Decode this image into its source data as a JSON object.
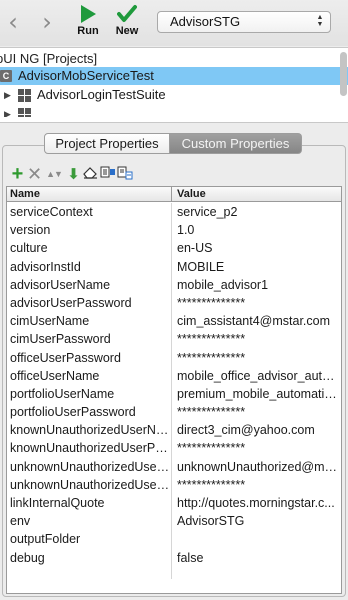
{
  "toolbar": {
    "run_label": "Run",
    "new_label": "New",
    "environment": "AdvisorSTG",
    "back_icon": "chevron-left-icon",
    "forward_icon": "chevron-right-icon",
    "run_icon": "play-icon",
    "new_icon": "checkmark-icon",
    "run_color": "#1f9a3c",
    "new_color": "#1f9a3c"
  },
  "tree": {
    "root_label": "pUI NG [Projects]",
    "suite_badge": "C",
    "suite_label": "AdvisorMobServiceTest",
    "login_suite_label": "AdvisorLoginTestSuite",
    "selection_color": "#7fc8f5"
  },
  "tabs": {
    "project": "Project Properties",
    "custom": "Custom Properties"
  },
  "table": {
    "headers": {
      "name": "Name",
      "value": "Value"
    },
    "rows": [
      {
        "name": "serviceContext",
        "value": "service_p2"
      },
      {
        "name": "version",
        "value": "1.0"
      },
      {
        "name": "culture",
        "value": "en-US"
      },
      {
        "name": "advisorInstId",
        "value": "MOBILE"
      },
      {
        "name": "advisorUserName",
        "value": "mobile_advisor1"
      },
      {
        "name": "advisorUserPassword",
        "value": "**************"
      },
      {
        "name": "cimUserName",
        "value": "cim_assistant4@mstar.com"
      },
      {
        "name": "cimUserPassword",
        "value": "**************"
      },
      {
        "name": "officeUserPassword",
        "value": "**************"
      },
      {
        "name": "officeUserName",
        "value": "mobile_office_advisor_auto..."
      },
      {
        "name": "portfolioUserName",
        "value": "premium_mobile_automatio..."
      },
      {
        "name": "portfolioUserPassword",
        "value": "**************"
      },
      {
        "name": "knownUnauthorizedUserNa...",
        "value": "direct3_cim@yahoo.com"
      },
      {
        "name": "knownUnauthorizedUserPas...",
        "value": "**************"
      },
      {
        "name": "unknownUnauthorizedUser...",
        "value": "unknownUnauthorized@mst..."
      },
      {
        "name": "unknownUnauthorizedUserP...",
        "value": "**************"
      },
      {
        "name": "linkInternalQuote",
        "value": "http://quotes.morningstar.c..."
      },
      {
        "name": "env",
        "value": "AdvisorSTG"
      },
      {
        "name": "outputFolder",
        "value": ""
      },
      {
        "name": "debug",
        "value": "false"
      }
    ]
  }
}
